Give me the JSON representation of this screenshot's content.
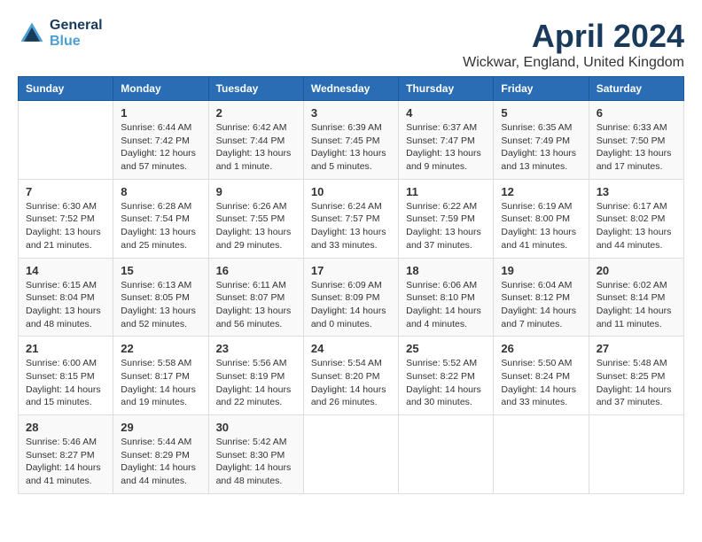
{
  "logo": {
    "line1": "General",
    "line2": "Blue"
  },
  "title": "April 2024",
  "subtitle": "Wickwar, England, United Kingdom",
  "weekdays": [
    "Sunday",
    "Monday",
    "Tuesday",
    "Wednesday",
    "Thursday",
    "Friday",
    "Saturday"
  ],
  "weeks": [
    [
      {
        "day": "",
        "sunrise": "",
        "sunset": "",
        "daylight": ""
      },
      {
        "day": "1",
        "sunrise": "Sunrise: 6:44 AM",
        "sunset": "Sunset: 7:42 PM",
        "daylight": "Daylight: 12 hours and 57 minutes."
      },
      {
        "day": "2",
        "sunrise": "Sunrise: 6:42 AM",
        "sunset": "Sunset: 7:44 PM",
        "daylight": "Daylight: 13 hours and 1 minute."
      },
      {
        "day": "3",
        "sunrise": "Sunrise: 6:39 AM",
        "sunset": "Sunset: 7:45 PM",
        "daylight": "Daylight: 13 hours and 5 minutes."
      },
      {
        "day": "4",
        "sunrise": "Sunrise: 6:37 AM",
        "sunset": "Sunset: 7:47 PM",
        "daylight": "Daylight: 13 hours and 9 minutes."
      },
      {
        "day": "5",
        "sunrise": "Sunrise: 6:35 AM",
        "sunset": "Sunset: 7:49 PM",
        "daylight": "Daylight: 13 hours and 13 minutes."
      },
      {
        "day": "6",
        "sunrise": "Sunrise: 6:33 AM",
        "sunset": "Sunset: 7:50 PM",
        "daylight": "Daylight: 13 hours and 17 minutes."
      }
    ],
    [
      {
        "day": "7",
        "sunrise": "Sunrise: 6:30 AM",
        "sunset": "Sunset: 7:52 PM",
        "daylight": "Daylight: 13 hours and 21 minutes."
      },
      {
        "day": "8",
        "sunrise": "Sunrise: 6:28 AM",
        "sunset": "Sunset: 7:54 PM",
        "daylight": "Daylight: 13 hours and 25 minutes."
      },
      {
        "day": "9",
        "sunrise": "Sunrise: 6:26 AM",
        "sunset": "Sunset: 7:55 PM",
        "daylight": "Daylight: 13 hours and 29 minutes."
      },
      {
        "day": "10",
        "sunrise": "Sunrise: 6:24 AM",
        "sunset": "Sunset: 7:57 PM",
        "daylight": "Daylight: 13 hours and 33 minutes."
      },
      {
        "day": "11",
        "sunrise": "Sunrise: 6:22 AM",
        "sunset": "Sunset: 7:59 PM",
        "daylight": "Daylight: 13 hours and 37 minutes."
      },
      {
        "day": "12",
        "sunrise": "Sunrise: 6:19 AM",
        "sunset": "Sunset: 8:00 PM",
        "daylight": "Daylight: 13 hours and 41 minutes."
      },
      {
        "day": "13",
        "sunrise": "Sunrise: 6:17 AM",
        "sunset": "Sunset: 8:02 PM",
        "daylight": "Daylight: 13 hours and 44 minutes."
      }
    ],
    [
      {
        "day": "14",
        "sunrise": "Sunrise: 6:15 AM",
        "sunset": "Sunset: 8:04 PM",
        "daylight": "Daylight: 13 hours and 48 minutes."
      },
      {
        "day": "15",
        "sunrise": "Sunrise: 6:13 AM",
        "sunset": "Sunset: 8:05 PM",
        "daylight": "Daylight: 13 hours and 52 minutes."
      },
      {
        "day": "16",
        "sunrise": "Sunrise: 6:11 AM",
        "sunset": "Sunset: 8:07 PM",
        "daylight": "Daylight: 13 hours and 56 minutes."
      },
      {
        "day": "17",
        "sunrise": "Sunrise: 6:09 AM",
        "sunset": "Sunset: 8:09 PM",
        "daylight": "Daylight: 14 hours and 0 minutes."
      },
      {
        "day": "18",
        "sunrise": "Sunrise: 6:06 AM",
        "sunset": "Sunset: 8:10 PM",
        "daylight": "Daylight: 14 hours and 4 minutes."
      },
      {
        "day": "19",
        "sunrise": "Sunrise: 6:04 AM",
        "sunset": "Sunset: 8:12 PM",
        "daylight": "Daylight: 14 hours and 7 minutes."
      },
      {
        "day": "20",
        "sunrise": "Sunrise: 6:02 AM",
        "sunset": "Sunset: 8:14 PM",
        "daylight": "Daylight: 14 hours and 11 minutes."
      }
    ],
    [
      {
        "day": "21",
        "sunrise": "Sunrise: 6:00 AM",
        "sunset": "Sunset: 8:15 PM",
        "daylight": "Daylight: 14 hours and 15 minutes."
      },
      {
        "day": "22",
        "sunrise": "Sunrise: 5:58 AM",
        "sunset": "Sunset: 8:17 PM",
        "daylight": "Daylight: 14 hours and 19 minutes."
      },
      {
        "day": "23",
        "sunrise": "Sunrise: 5:56 AM",
        "sunset": "Sunset: 8:19 PM",
        "daylight": "Daylight: 14 hours and 22 minutes."
      },
      {
        "day": "24",
        "sunrise": "Sunrise: 5:54 AM",
        "sunset": "Sunset: 8:20 PM",
        "daylight": "Daylight: 14 hours and 26 minutes."
      },
      {
        "day": "25",
        "sunrise": "Sunrise: 5:52 AM",
        "sunset": "Sunset: 8:22 PM",
        "daylight": "Daylight: 14 hours and 30 minutes."
      },
      {
        "day": "26",
        "sunrise": "Sunrise: 5:50 AM",
        "sunset": "Sunset: 8:24 PM",
        "daylight": "Daylight: 14 hours and 33 minutes."
      },
      {
        "day": "27",
        "sunrise": "Sunrise: 5:48 AM",
        "sunset": "Sunset: 8:25 PM",
        "daylight": "Daylight: 14 hours and 37 minutes."
      }
    ],
    [
      {
        "day": "28",
        "sunrise": "Sunrise: 5:46 AM",
        "sunset": "Sunset: 8:27 PM",
        "daylight": "Daylight: 14 hours and 41 minutes."
      },
      {
        "day": "29",
        "sunrise": "Sunrise: 5:44 AM",
        "sunset": "Sunset: 8:29 PM",
        "daylight": "Daylight: 14 hours and 44 minutes."
      },
      {
        "day": "30",
        "sunrise": "Sunrise: 5:42 AM",
        "sunset": "Sunset: 8:30 PM",
        "daylight": "Daylight: 14 hours and 48 minutes."
      },
      {
        "day": "",
        "sunrise": "",
        "sunset": "",
        "daylight": ""
      },
      {
        "day": "",
        "sunrise": "",
        "sunset": "",
        "daylight": ""
      },
      {
        "day": "",
        "sunrise": "",
        "sunset": "",
        "daylight": ""
      },
      {
        "day": "",
        "sunrise": "",
        "sunset": "",
        "daylight": ""
      }
    ]
  ]
}
